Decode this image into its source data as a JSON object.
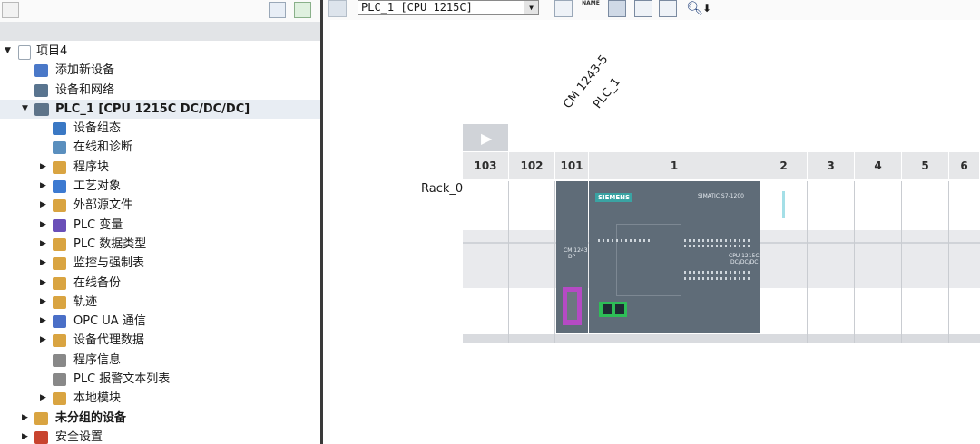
{
  "tree": {
    "project": "项目4",
    "add_device": "添加新设备",
    "devices_networks": "设备和网络",
    "plc": "PLC_1 [CPU 1215C DC/DC/DC]",
    "items": [
      {
        "label": "设备组态",
        "arrow": false,
        "icon": "device-config-icon",
        "color": "#3a78c4"
      },
      {
        "label": "在线和诊断",
        "arrow": false,
        "icon": "online-diagnostics-icon",
        "color": "#5a8fbe"
      },
      {
        "label": "程序块",
        "arrow": true,
        "icon": "program-blocks-icon",
        "color": "#d9a441"
      },
      {
        "label": "工艺对象",
        "arrow": true,
        "icon": "technology-objects-icon",
        "color": "#3d7ad1"
      },
      {
        "label": "外部源文件",
        "arrow": true,
        "icon": "external-sources-icon",
        "color": "#d9a441"
      },
      {
        "label": "PLC 变量",
        "arrow": true,
        "icon": "plc-tags-icon",
        "color": "#6a4fb8"
      },
      {
        "label": "PLC 数据类型",
        "arrow": true,
        "icon": "plc-datatypes-icon",
        "color": "#d9a441"
      },
      {
        "label": "监控与强制表",
        "arrow": true,
        "icon": "watch-force-tables-icon",
        "color": "#d9a441"
      },
      {
        "label": "在线备份",
        "arrow": true,
        "icon": "online-backups-icon",
        "color": "#d9a441"
      },
      {
        "label": "轨迹",
        "arrow": true,
        "icon": "traces-icon",
        "color": "#d9a441"
      },
      {
        "label": "OPC UA 通信",
        "arrow": true,
        "icon": "opc-ua-icon",
        "color": "#4a6fc7"
      },
      {
        "label": "设备代理数据",
        "arrow": true,
        "icon": "device-proxy-icon",
        "color": "#d9a441"
      },
      {
        "label": "程序信息",
        "arrow": false,
        "icon": "program-info-icon",
        "color": "#888888"
      },
      {
        "label": "PLC 报警文本列表",
        "arrow": false,
        "icon": "alarm-text-icon",
        "color": "#888888"
      },
      {
        "label": "本地模块",
        "arrow": true,
        "icon": "local-modules-icon",
        "color": "#d9a441"
      }
    ],
    "ungrouped": "未分组的设备",
    "security": "安全设置"
  },
  "toolbar": {
    "device_select": "PLC_1 [CPU 1215C]",
    "name_icon_text": "NAME"
  },
  "rack": {
    "label": "Rack_0",
    "slots": [
      "103",
      "102",
      "101",
      "1",
      "2",
      "3",
      "4",
      "5",
      "6"
    ],
    "labels_rotated": [
      "CM 1243-5",
      "PLC_1"
    ]
  },
  "module": {
    "brand": "SIEMENS",
    "product": "SIMATIC S7-1200",
    "cpu_text": "CPU 1215C",
    "cpu_sub": "DC/DC/DC",
    "cm_text": "CM 1243",
    "cm_sub": "DP"
  },
  "colors": {
    "module": "#5f6c78",
    "profinet_port": "#2ebd57",
    "dp_port": "#b54ac4",
    "slot_header": "#e6e7e9"
  }
}
